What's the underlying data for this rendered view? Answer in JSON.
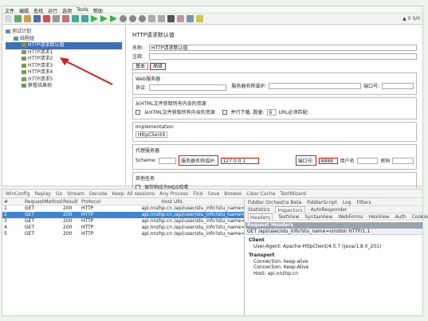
{
  "jmeter": {
    "menu": [
      "文件",
      "编辑",
      "查找",
      "运行",
      "选项",
      "Tools",
      "帮助"
    ],
    "tree": [
      {
        "label": "测试计划",
        "level": 0,
        "selected": false
      },
      {
        "label": "线程组",
        "level": 1,
        "selected": false
      },
      {
        "label": "HTTP请求默认值",
        "level": 2,
        "selected": true
      },
      {
        "label": "HTTP请求1",
        "level": 2,
        "selected": false
      },
      {
        "label": "HTTP请求2",
        "level": 2,
        "selected": false
      },
      {
        "label": "HTTP请求3",
        "level": 2,
        "selected": false
      },
      {
        "label": "HTTP请求4",
        "level": 2,
        "selected": false
      },
      {
        "label": "HTTP请求5",
        "level": 2,
        "selected": false
      },
      {
        "label": "察看结果树",
        "level": 2,
        "selected": false
      }
    ],
    "form": {
      "title": "HTTP请求默认值",
      "name_label": "名称:",
      "name_value": "HTTP请求默认值",
      "comment_label": "注释:",
      "tabs": [
        "基本",
        "高级"
      ],
      "web_server_title": "Web服务器",
      "protocol_label": "协议:",
      "server_label": "服务器名称或IP:",
      "port_label": "端口号:",
      "embedded_title": "从HTML文件获取所有内含的资源",
      "embedded_checkbox": "从HTML文件获取所有内含的资源",
      "parallel_label": "并行下载. 数量:",
      "parallel_value": "6",
      "url_filter_label": "URL必须匹配:",
      "impl_title": "Implementation",
      "impl_value": "HttpClient4",
      "proxy_title": "代理服务器",
      "scheme_label": "Scheme:",
      "proxy_server_label": "服务器名称或IP:",
      "proxy_server_value": "127.0.0.1",
      "proxy_port_label": "端口号:",
      "proxy_port_value": "8888",
      "user_label": "用户名",
      "password_label": "密码",
      "other_title": "其他任务",
      "md5_label": "保存响应为MD5哈希"
    }
  },
  "fiddler": {
    "toolbar": [
      "WinConfig",
      "Replay",
      "Go",
      "Stream",
      "Decode",
      "Keep: All sessions",
      "Any Process",
      "Find",
      "Save",
      "Browse",
      "Clear Cache",
      "TextWizard"
    ],
    "columns": [
      "#",
      "Result",
      "Protocol",
      "Host",
      "URL"
    ],
    "rows": [
      {
        "num": "1",
        "method": "GET",
        "result": "200",
        "protocol": "HTTP",
        "host": "api.nnzhp.cn",
        "url": "/api/user/stu_info?stu_name=",
        "hl": false
      },
      {
        "num": "2",
        "method": "GET",
        "result": "200",
        "protocol": "HTTP",
        "host": "api.nnzhp.cn",
        "url": "/api/user/stu_info?stu_name=",
        "hl": true
      },
      {
        "num": "3",
        "method": "GET",
        "result": "200",
        "protocol": "HTTP",
        "host": "api.nnzhp.cn",
        "url": "/api/user/stu_info?stu_name=",
        "hl": false
      },
      {
        "num": "4",
        "method": "GET",
        "result": "200",
        "protocol": "HTTP",
        "host": "api.nnzhp.cn",
        "url": "/api/user/stu_info?stu_name=",
        "hl": false
      },
      {
        "num": "5",
        "method": "GET",
        "result": "200",
        "protocol": "HTTP",
        "host": "api.nnzhp.cn",
        "url": "/api/user/stu_info?stu_name=",
        "hl": false
      }
    ],
    "top_tabs": [
      "Fiddler Orchestra Beta",
      "FiddlerScript",
      "Log",
      "Filters"
    ],
    "sub_tabs": [
      "Statistics",
      "Inspectors",
      "AutoResponder"
    ],
    "insp_tabs": [
      "Headers",
      "TextView",
      "SyntaxView",
      "WebForms",
      "HexView",
      "Auth",
      "Cookies"
    ],
    "request_headers_title": "Request Headers",
    "request_line": "GET /api/user/stu_info?stu_name=vinston HTTP/1.1",
    "sections": [
      {
        "title": "Client",
        "lines": [
          "User-Agent: Apache-HttpClient/4.5.7 (Java/1.8.0_201)"
        ]
      },
      {
        "title": "Transport",
        "lines": [
          "Connection: keep-alive",
          "Connection: Keep-Alive",
          "Host: api.nnzhp.cn"
        ]
      }
    ]
  },
  "colors": {
    "highlight": "#3d86d6",
    "tree_selected": "#3d6fbf",
    "annotation_red": "#d32020"
  }
}
